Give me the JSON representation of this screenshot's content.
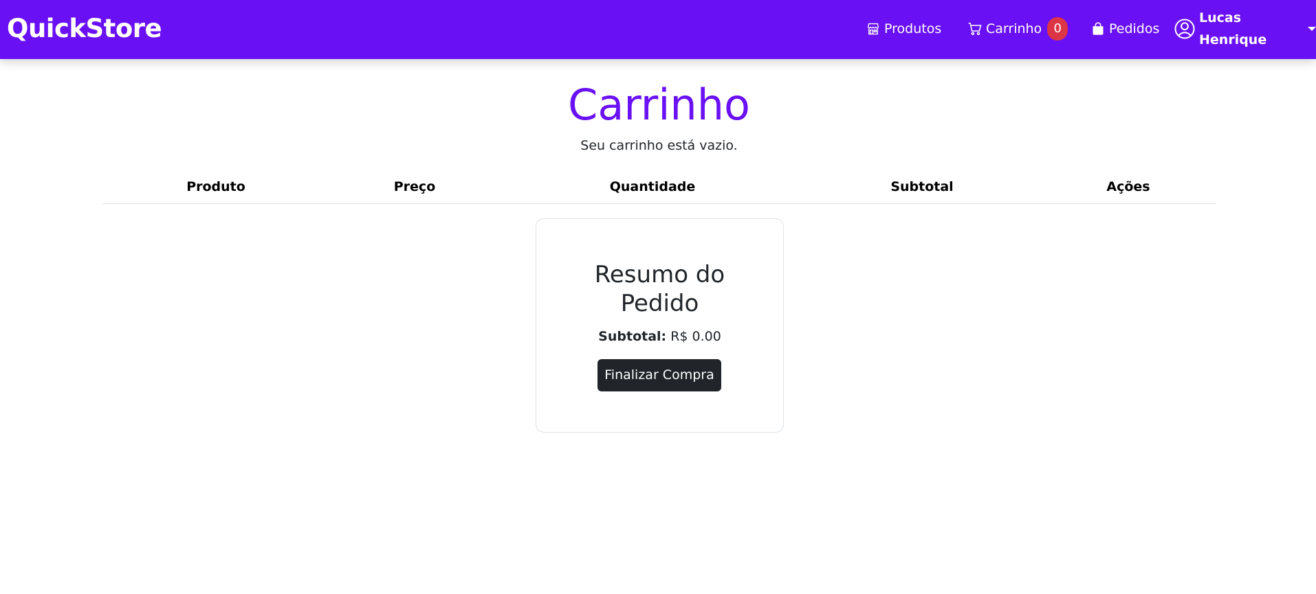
{
  "navbar": {
    "brand": "QuickStore",
    "background_color": "#6a10f4",
    "items": [
      {
        "label": "Produtos",
        "icon": "shop-icon"
      },
      {
        "label": "Carrinho",
        "icon": "cart-icon",
        "badge": "0",
        "badge_color": "#dc3545"
      },
      {
        "label": "Pedidos",
        "icon": "bag-icon"
      }
    ],
    "user": {
      "name": "Lucas Henrique",
      "icon": "user-circle-icon"
    }
  },
  "main": {
    "title": "Carrinho",
    "title_color": "#6a10f4",
    "empty_message": "Seu carrinho está vazio.",
    "table": {
      "headers": [
        "Produto",
        "Preço",
        "Quantidade",
        "Subtotal",
        "Ações"
      ],
      "rows": []
    },
    "summary": {
      "title": "Resumo do Pedido",
      "subtotal_label": "Subtotal:",
      "subtotal_value": "R$ 0.00",
      "checkout_label": "Finalizar Compra"
    }
  }
}
